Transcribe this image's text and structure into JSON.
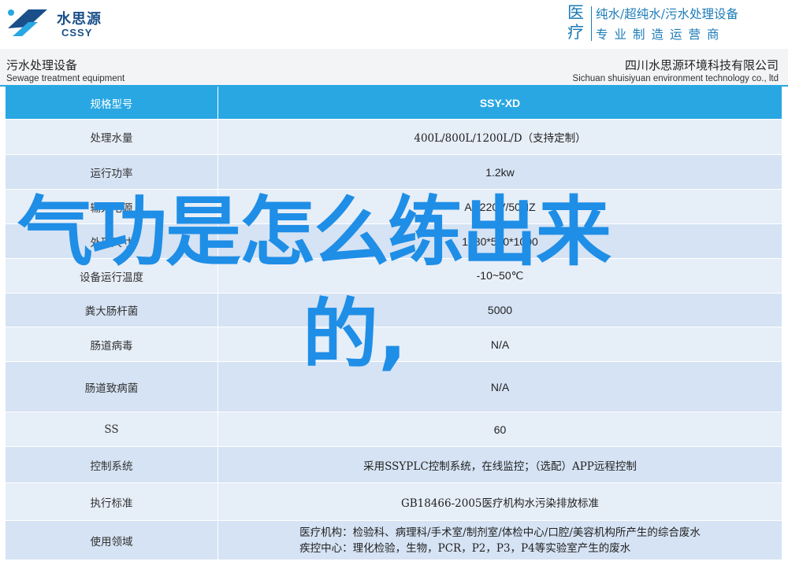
{
  "header": {
    "logo_cn": "水思源",
    "logo_en": "CSSY",
    "slogan_big": "医疗",
    "slogan_line1": "纯水/超纯水/污水处理设备",
    "slogan_line2": "专业制造运营商"
  },
  "subheader": {
    "left_cn": "污水处理设备",
    "left_en": "Sewage treatment equipment",
    "right_cn": "四川水思源环境科技有限公司",
    "right_en": "Sichuan shuisiyuan environment technology co., ltd"
  },
  "table": {
    "header": {
      "label": "规格型号",
      "value": "SSY-XD"
    },
    "rows": [
      {
        "label": "处理水量",
        "value": "400L/800L/1200L/D（支持定制）"
      },
      {
        "label": "运行功率",
        "value": "1.2kw"
      },
      {
        "label": "输入电源",
        "value": "AC220V/50HZ"
      },
      {
        "label": "外形尺寸",
        "value": "1080*560*1000"
      },
      {
        "label": "设备运行温度",
        "value": "-10~50℃"
      },
      {
        "label": "粪大肠杆菌",
        "value": "5000"
      },
      {
        "label": "肠道病毒",
        "value": "N/A"
      },
      {
        "label": "肠道致病菌",
        "value": "N/A"
      },
      {
        "label": "SS",
        "value": "60"
      },
      {
        "label": "控制系统",
        "value": "采用SSYPLC控制系统，在线监控；（选配）APP远程控制"
      },
      {
        "label": "执行标准",
        "value": "GB18466-2005医疗机构水污染排放标准"
      },
      {
        "label": "使用领域",
        "line1": "医疗机构：检验科、病理科/手术室/制剂室/体检中心/口腔/美容机构所产生的综合废水",
        "line2": "疾控中心：理化检验，生物，PCR，P2，P3，P4等实验室产生的废水"
      }
    ]
  },
  "overlay": {
    "line1": "气功是怎么练出来",
    "line2": "的,"
  },
  "colors": {
    "brand_blue": "#1a4f8a",
    "accent_blue": "#29a7e3",
    "overlay_blue": "#1f8ee6",
    "row_light": "#e6eef8",
    "row_dark": "#d5e3f4"
  }
}
